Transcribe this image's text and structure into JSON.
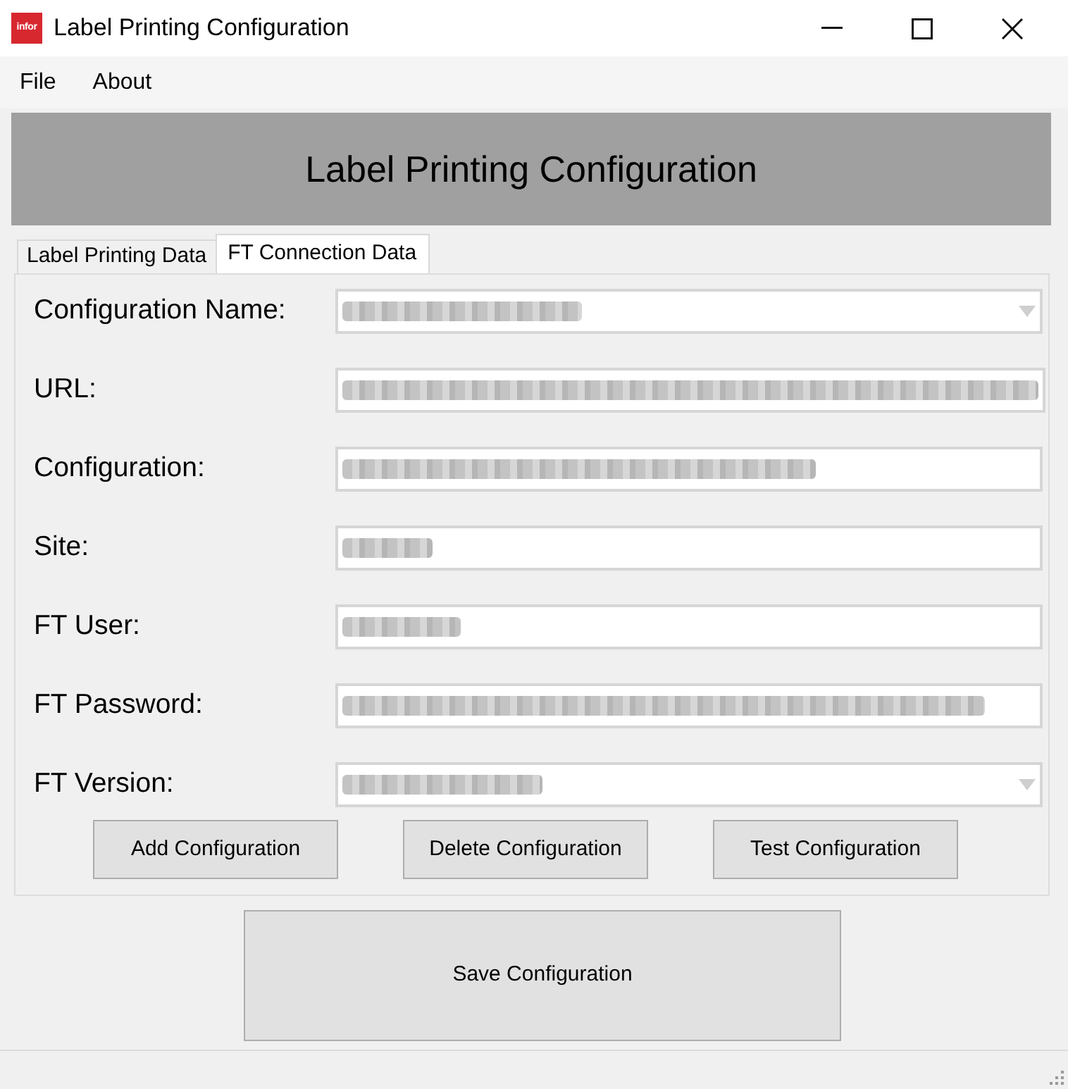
{
  "window": {
    "title": "Label Printing Configuration",
    "logo_text": "infor"
  },
  "menu": [
    {
      "label": "File"
    },
    {
      "label": "About"
    }
  ],
  "header": {
    "title": "Label Printing Configuration"
  },
  "tabs": [
    {
      "label": "Label Printing Data",
      "selected": false
    },
    {
      "label": "FT Connection Data",
      "selected": true
    }
  ],
  "fields": [
    {
      "label": "Configuration Name:",
      "kind": "dropdown",
      "redacted": true
    },
    {
      "label": "URL:",
      "kind": "textbox",
      "redacted": true
    },
    {
      "label": "Configuration:",
      "kind": "textbox",
      "redacted": true
    },
    {
      "label": "Site:",
      "kind": "textbox",
      "redacted": true
    },
    {
      "label": "FT User:",
      "kind": "textbox",
      "redacted": true
    },
    {
      "label": "FT Password:",
      "kind": "password",
      "redacted": true
    },
    {
      "label": "FT Version:",
      "kind": "dropdown",
      "redacted": true
    }
  ],
  "buttons": [
    {
      "label": "Add Configuration"
    },
    {
      "label": "Delete Configuration"
    },
    {
      "label": "Test Configuration"
    }
  ],
  "save_button": {
    "label": "Save Configuration"
  }
}
